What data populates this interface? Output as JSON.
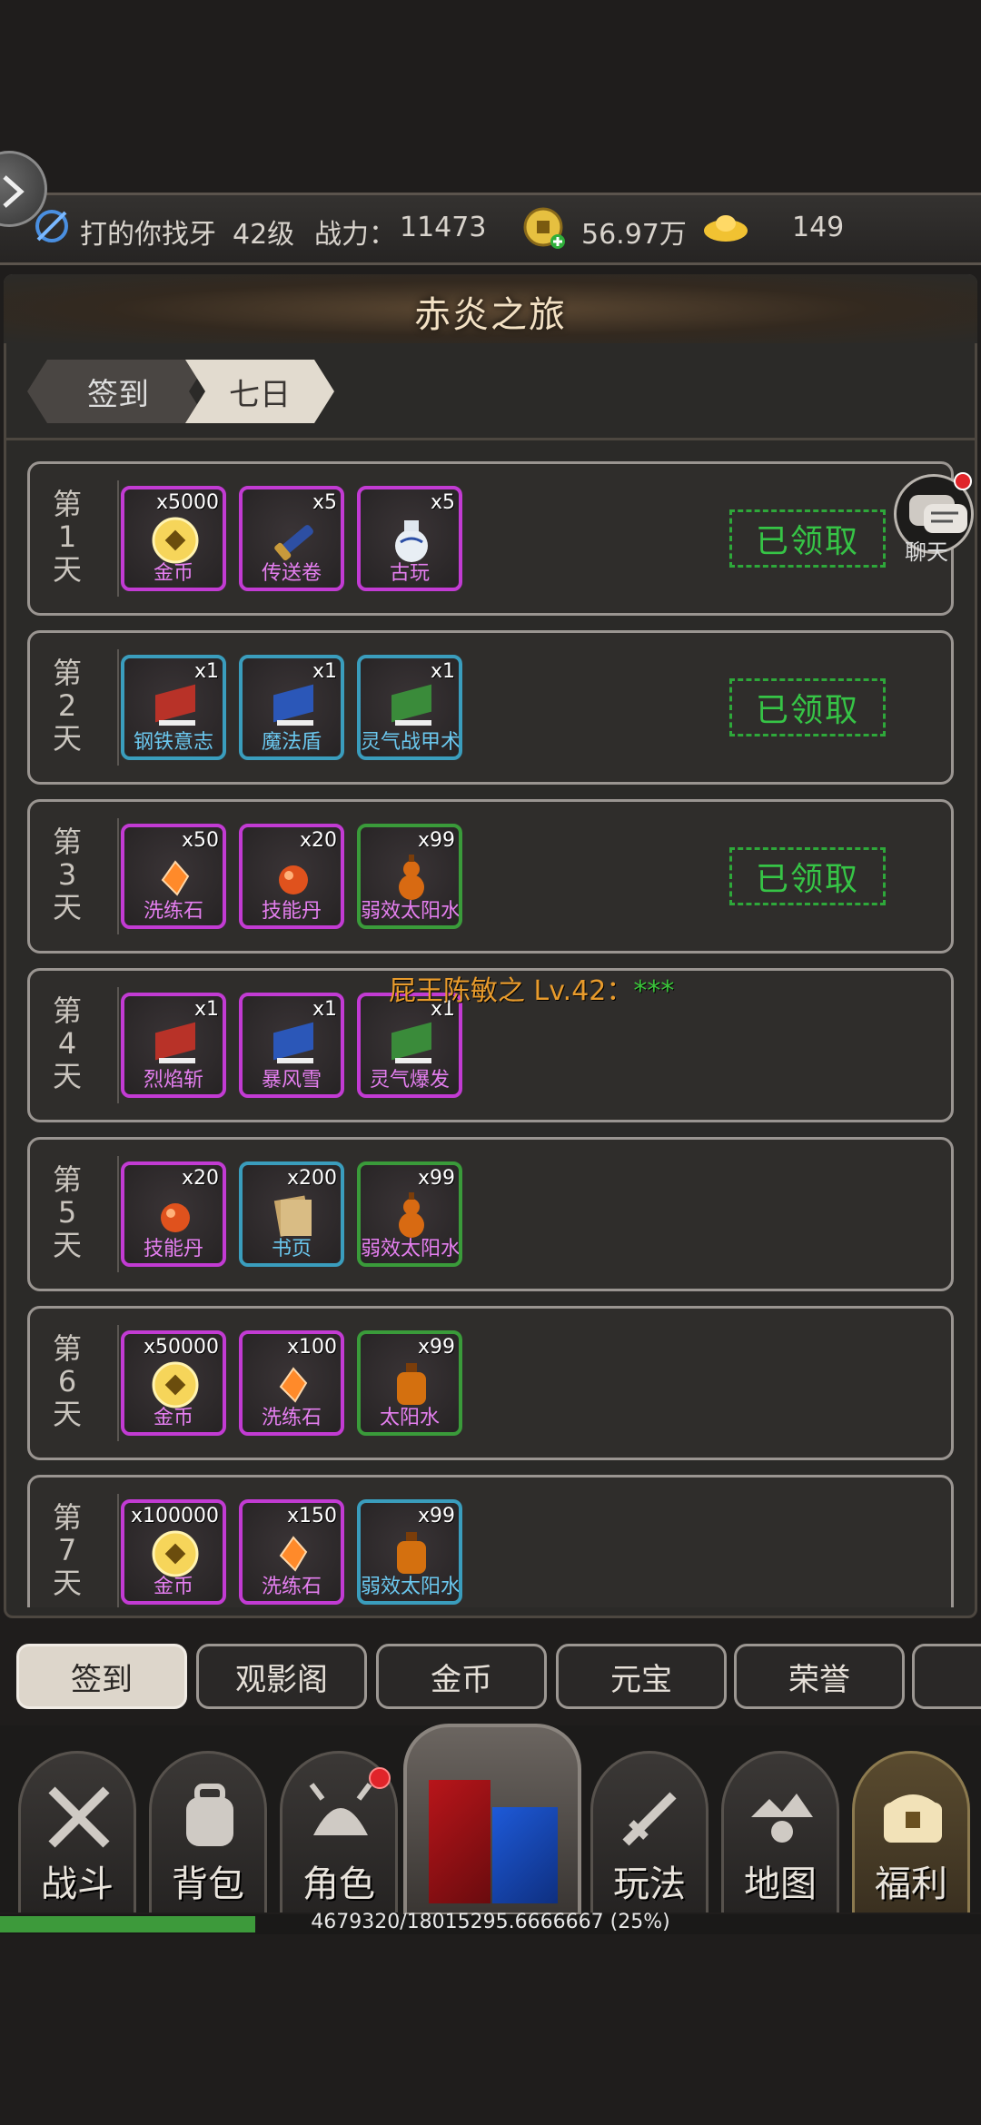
{
  "status_bar": {
    "player_name": "打的你找牙",
    "level": "42级",
    "power_label": "战力：",
    "power_value": "11473",
    "coins": "56.97万",
    "ingots": "149"
  },
  "panel": {
    "title": "赤炎之旅",
    "tabs": [
      {
        "label": "签到",
        "active": false
      },
      {
        "label": "七日",
        "active": true
      }
    ]
  },
  "chat": {
    "label": "聊天"
  },
  "days": [
    {
      "label": [
        "第",
        "1",
        "天"
      ],
      "claimed": true,
      "items": [
        {
          "name": "金币",
          "qty": "x5000",
          "rarity": "purple",
          "icon": "coin-icon"
        },
        {
          "name": "传送卷",
          "qty": "x5",
          "rarity": "purple",
          "icon": "scroll-icon"
        },
        {
          "name": "古玩",
          "qty": "x5",
          "rarity": "purple",
          "icon": "vase-icon"
        }
      ]
    },
    {
      "label": [
        "第",
        "2",
        "天"
      ],
      "claimed": true,
      "items": [
        {
          "name": "钢铁意志",
          "qty": "x1",
          "rarity": "blue",
          "icon": "red-book-icon"
        },
        {
          "name": "魔法盾",
          "qty": "x1",
          "rarity": "blue",
          "icon": "blue-book-icon"
        },
        {
          "name": "灵气战甲术",
          "qty": "x1",
          "rarity": "blue",
          "icon": "green-book-icon"
        }
      ]
    },
    {
      "label": [
        "第",
        "3",
        "天"
      ],
      "claimed": true,
      "items": [
        {
          "name": "洗练石",
          "qty": "x50",
          "rarity": "purple",
          "icon": "gem-icon"
        },
        {
          "name": "技能丹",
          "qty": "x20",
          "rarity": "purple",
          "icon": "pill-icon"
        },
        {
          "name": "弱效太阳水",
          "qty": "x99",
          "rarity": "green",
          "icon": "gourd-icon"
        }
      ]
    },
    {
      "label": [
        "第",
        "4",
        "天"
      ],
      "claimed": false,
      "items": [
        {
          "name": "烈焰斩",
          "qty": "x1",
          "rarity": "purple",
          "icon": "red-book-icon"
        },
        {
          "name": "暴风雪",
          "qty": "x1",
          "rarity": "purple",
          "icon": "blue-book-icon"
        },
        {
          "name": "灵气爆发",
          "qty": "x1",
          "rarity": "purple",
          "icon": "green-book-icon"
        }
      ]
    },
    {
      "label": [
        "第",
        "5",
        "天"
      ],
      "claimed": false,
      "items": [
        {
          "name": "技能丹",
          "qty": "x20",
          "rarity": "purple",
          "icon": "pill-icon"
        },
        {
          "name": "书页",
          "qty": "x200",
          "rarity": "blue",
          "icon": "paper-icon"
        },
        {
          "name": "弱效太阳水",
          "qty": "x99",
          "rarity": "green",
          "icon": "gourd-icon"
        }
      ]
    },
    {
      "label": [
        "第",
        "6",
        "天"
      ],
      "claimed": false,
      "items": [
        {
          "name": "金币",
          "qty": "x50000",
          "rarity": "purple",
          "icon": "coin-icon"
        },
        {
          "name": "洗练石",
          "qty": "x100",
          "rarity": "purple",
          "icon": "gem-icon"
        },
        {
          "name": "太阳水",
          "qty": "x99",
          "rarity": "green",
          "icon": "bottle-icon"
        }
      ]
    },
    {
      "label": [
        "第",
        "7",
        "天"
      ],
      "claimed": false,
      "items": [
        {
          "name": "金币",
          "qty": "x100000",
          "rarity": "purple",
          "icon": "coin-icon"
        },
        {
          "name": "洗练石",
          "qty": "x150",
          "rarity": "purple",
          "icon": "gem-icon"
        },
        {
          "name": "弱效太阳水",
          "qty": "x99",
          "rarity": "blue",
          "icon": "bottle-icon"
        }
      ]
    }
  ],
  "claimed_label": "已领取",
  "broadcast": {
    "text": "屁王陈敏之 Lv.42：",
    "stars": "***"
  },
  "sub_tabs": [
    "签到",
    "观影阁",
    "金币",
    "元宝",
    "荣誉"
  ],
  "bottom_nav": [
    {
      "label": "战斗",
      "icon": "crossed-swords-icon"
    },
    {
      "label": "背包",
      "icon": "backpack-icon"
    },
    {
      "label": "角色",
      "icon": "helmet-icon"
    },
    {
      "label": "玩法",
      "icon": "sword-icon"
    },
    {
      "label": "地图",
      "icon": "map-icon"
    },
    {
      "label": "福利",
      "icon": "treasure-chest-icon",
      "active": true
    }
  ],
  "exp": {
    "text": "4679320/18015295.6666667 (25%)",
    "fraction": 0.26
  },
  "colors": {
    "claimed": "#36c446",
    "purple_frame": "#c23bd3",
    "blue_frame": "#3a9dbd",
    "green_frame": "#3a9b3a"
  }
}
